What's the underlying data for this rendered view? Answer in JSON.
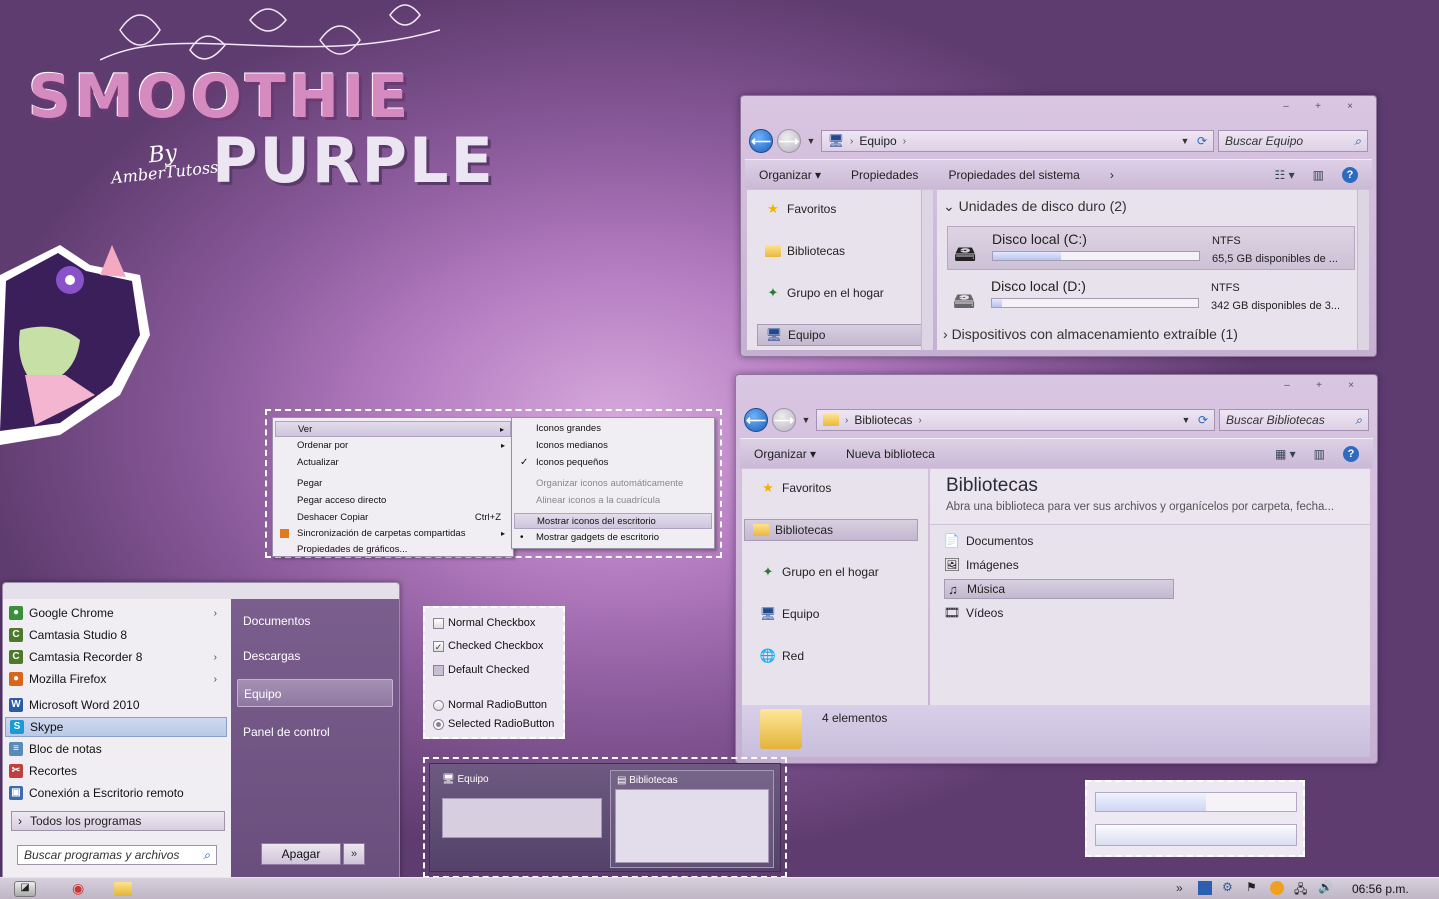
{
  "logo": {
    "line1": "SMOOTHIE",
    "line2": "PURPLE",
    "by": "By",
    "author": "AmberTutoss"
  },
  "equipo_window": {
    "caption": {
      "min": "–",
      "max": "+",
      "close": "×"
    },
    "address": "Equipo",
    "search_placeholder": "Buscar Equipo",
    "toolbar": {
      "organize": "Organizar",
      "properties": "Propiedades",
      "system_properties": "Propiedades del sistema"
    },
    "nav": [
      {
        "label": "Favoritos",
        "icon": "star-icon"
      },
      {
        "label": "Bibliotecas",
        "icon": "library-icon"
      },
      {
        "label": "Grupo en el hogar",
        "icon": "homegroup-icon"
      },
      {
        "label": "Equipo",
        "icon": "computer-icon"
      }
    ],
    "group_hdd": "Unidades de disco duro (2)",
    "drives": [
      {
        "name": "Disco local (C:)",
        "fs": "NTFS",
        "free": "65,5 GB disponibles de ...",
        "fill": 0.33
      },
      {
        "name": "Disco local (D:)",
        "fs": "NTFS",
        "free": "342 GB disponibles de 3...",
        "fill": 0.05
      }
    ],
    "group_removable": "Dispositivos con almacenamiento extraíble (1)"
  },
  "biblio_window": {
    "caption": {
      "min": "–",
      "max": "+",
      "close": "×"
    },
    "address": "Bibliotecas",
    "search_placeholder": "Buscar Bibliotecas",
    "toolbar": {
      "organize": "Organizar",
      "new_library": "Nueva biblioteca"
    },
    "nav": [
      {
        "label": "Favoritos"
      },
      {
        "label": "Bibliotecas"
      },
      {
        "label": "Grupo en el hogar"
      },
      {
        "label": "Equipo"
      },
      {
        "label": "Red"
      }
    ],
    "title": "Bibliotecas",
    "subtitle": "Abra una biblioteca para ver sus archivos y organícelos por carpeta, fecha...",
    "items": [
      "Documentos",
      "Imágenes",
      "Música",
      "Vídeos"
    ],
    "status": "4 elementos"
  },
  "context_menu": {
    "main": [
      {
        "label": "Ver",
        "sub": "▸"
      },
      {
        "label": "Ordenar por",
        "sub": "▸"
      },
      {
        "label": "Actualizar"
      },
      {
        "label": "Pegar"
      },
      {
        "label": "Pegar acceso directo"
      },
      {
        "label": "Deshacer Copiar",
        "shortcut": "Ctrl+Z"
      },
      {
        "label": "Sincronización de carpetas compartidas",
        "sub": "▸"
      },
      {
        "label": "Propiedades de gráficos..."
      }
    ],
    "view": [
      {
        "label": "Iconos grandes"
      },
      {
        "label": "Iconos medianos"
      },
      {
        "label": "Iconos pequeños",
        "check": "✓"
      },
      {
        "label": "Organizar iconos automáticamente"
      },
      {
        "label": "Alinear iconos a la cuadrícula"
      },
      {
        "label": "Mostrar iconos del escritorio"
      },
      {
        "label": "Mostrar gadgets de escritorio",
        "check": "•"
      }
    ]
  },
  "start_menu": {
    "programs": [
      {
        "label": "Google Chrome",
        "arrow": "›",
        "color": "#3a8f3a",
        "glyph": "●"
      },
      {
        "label": "Camtasia Studio 8",
        "color": "#4d7a2a",
        "glyph": "C"
      },
      {
        "label": "Camtasia Recorder 8",
        "arrow": "›",
        "color": "#4d7a2a",
        "glyph": "C"
      },
      {
        "label": "Mozilla Firefox",
        "arrow": "›",
        "color": "#d8651a",
        "glyph": "●"
      },
      {
        "label": "Microsoft Word 2010",
        "color": "#2b5aa8",
        "glyph": "W"
      },
      {
        "label": "Skype",
        "color": "#1a9ad8",
        "glyph": "S"
      },
      {
        "label": "Bloc de notas",
        "color": "#5a8ab8",
        "glyph": "≡"
      },
      {
        "label": "Recortes",
        "color": "#c04040",
        "glyph": "✂"
      },
      {
        "label": "Conexión a Escritorio remoto",
        "color": "#3a6ab0",
        "glyph": "▣"
      }
    ],
    "all_programs": "Todos los programas",
    "search_placeholder": "Buscar programas y archivos",
    "places": [
      "Documentos",
      "Descargas",
      "Equipo",
      "Panel de control"
    ],
    "shutdown": "Apagar",
    "shutdown_arrow": "»"
  },
  "controls": {
    "checkboxes": [
      "Normal Checkbox",
      "Checked Checkbox",
      "Default Checked"
    ],
    "radios": [
      "Normal RadioButton",
      "Selected RadioButton"
    ]
  },
  "thumbnails": {
    "left": "Equipo",
    "right": "Bibliotecas"
  },
  "taskbar": {
    "time": "06:56 p.m."
  },
  "colors": {
    "accent": "#8a5a9a",
    "selection": "#c4b8cf"
  }
}
